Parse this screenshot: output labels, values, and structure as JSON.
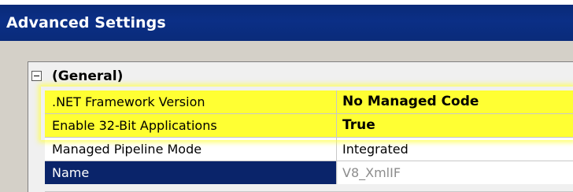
{
  "window": {
    "title": "Advanced Settings"
  },
  "category": {
    "label": "(General)",
    "expanded": true,
    "icon": "collapse-minus-icon"
  },
  "properties": [
    {
      "name": ".NET Framework Version",
      "value": "No Managed Code",
      "highlighted": true
    },
    {
      "name": "Enable 32-Bit Applications",
      "value": "True",
      "highlighted": true
    },
    {
      "name": "Managed Pipeline Mode",
      "value": "Integrated",
      "highlighted": false
    },
    {
      "name": "Name",
      "value": "V8_XmlIF",
      "selected": true
    }
  ],
  "colors": {
    "title_bar": "#0b2f86",
    "highlight": "#ffff33",
    "selection": "#0a246a",
    "panel": "#d4d0c8"
  }
}
